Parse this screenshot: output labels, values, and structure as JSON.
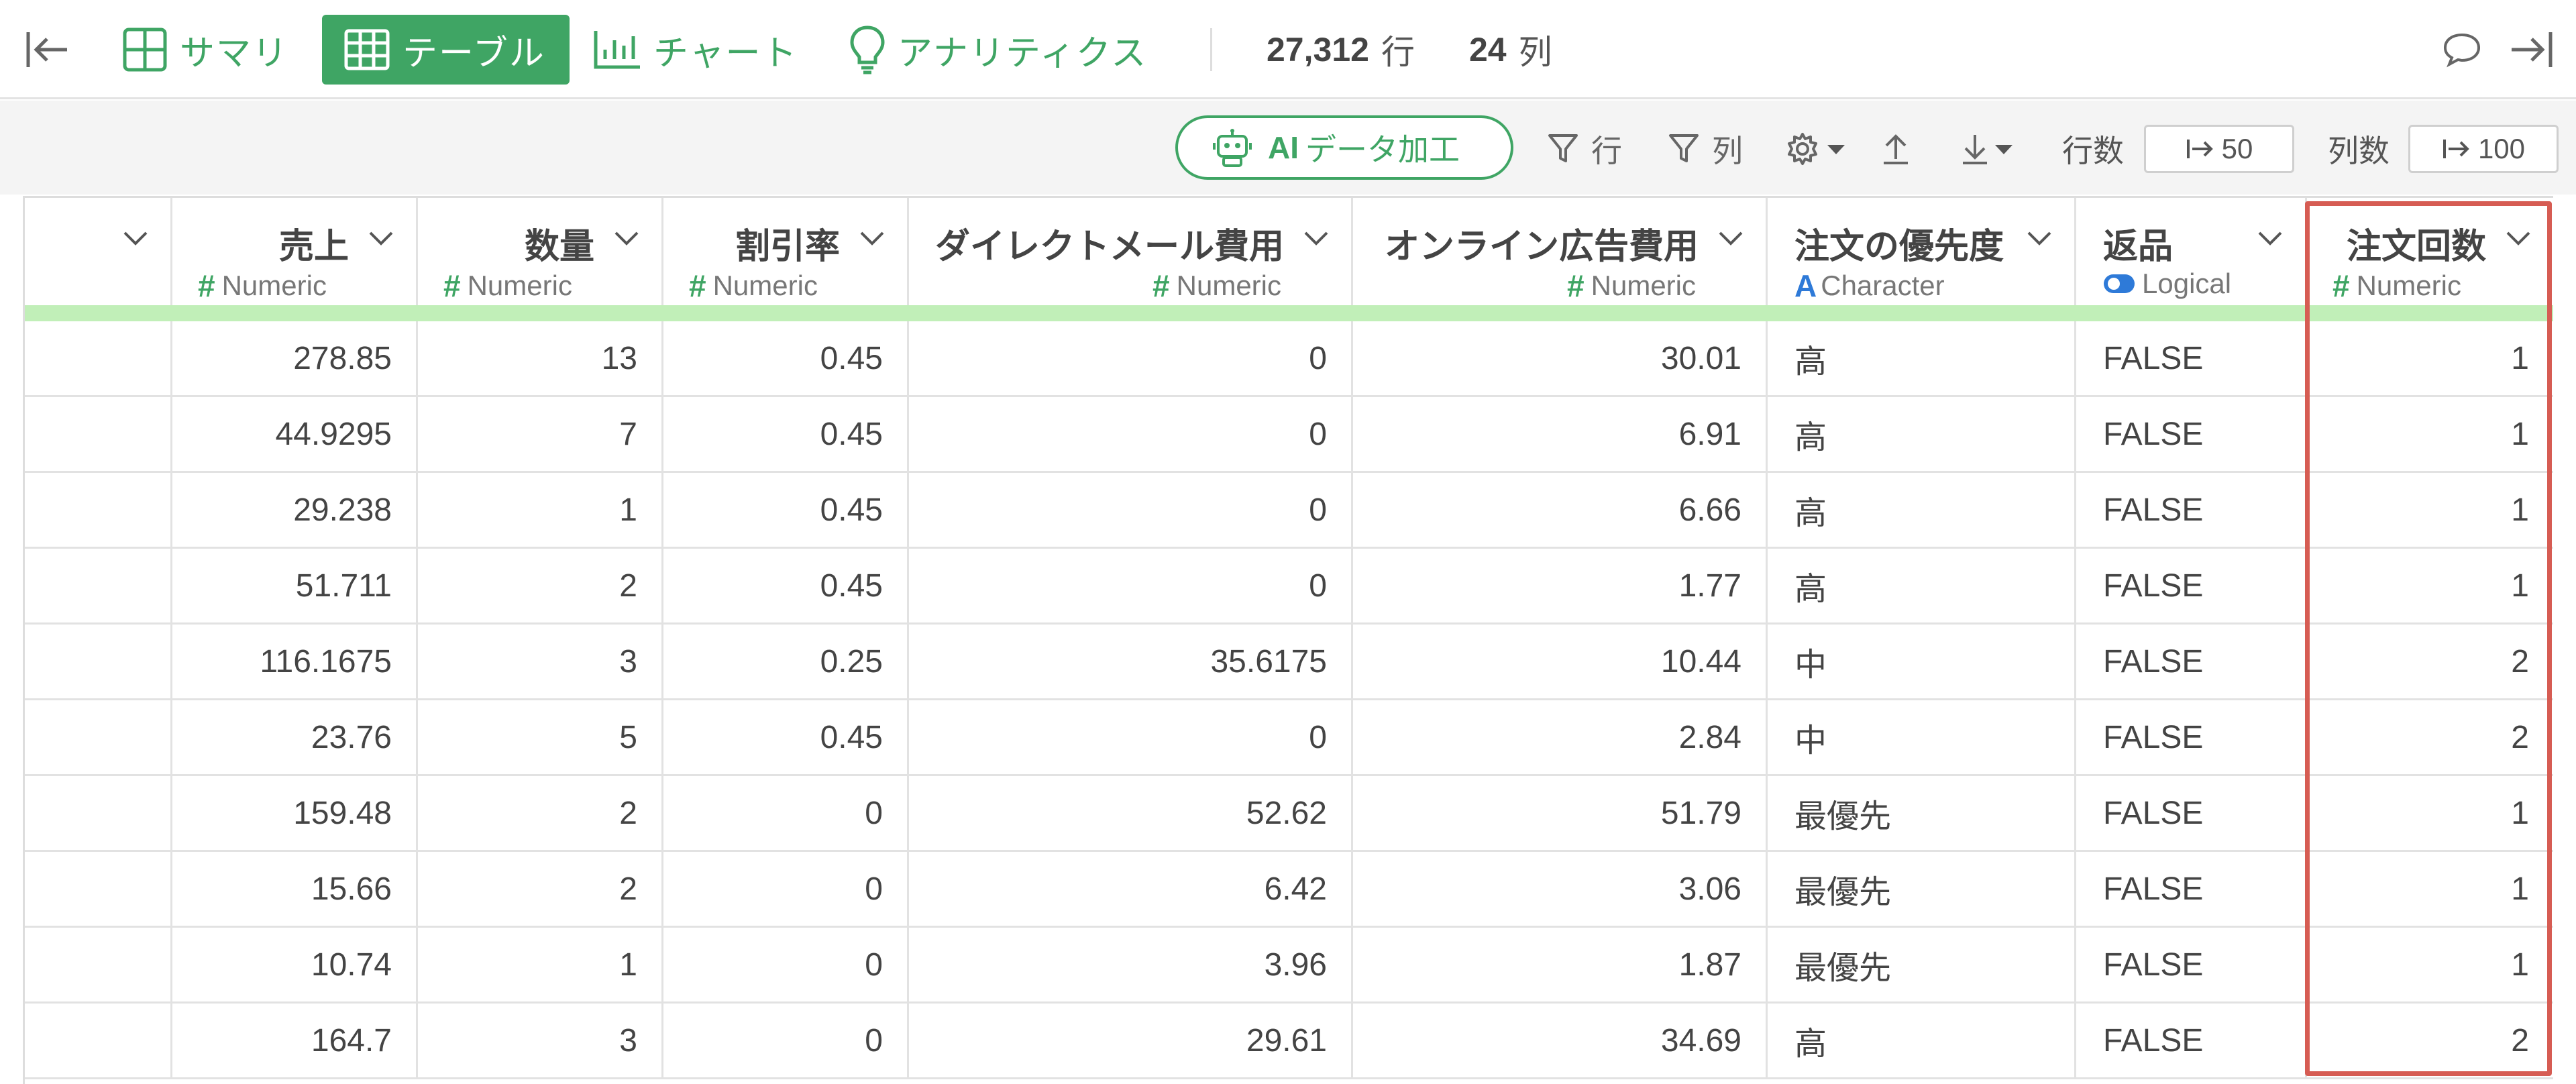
{
  "nav": {
    "tabs": [
      {
        "label": "サマリ",
        "icon": "summary-grid-icon"
      },
      {
        "label": "テーブル",
        "icon": "table-icon",
        "active": true
      },
      {
        "label": "チャート",
        "icon": "bar-chart-icon"
      },
      {
        "label": "アナリティクス",
        "icon": "lightbulb-icon"
      }
    ],
    "rows_count": "27,312",
    "rows_unit": "行",
    "cols_count": "24",
    "cols_unit": "列"
  },
  "toolbar": {
    "ai_strong": "AI",
    "ai_label": "データ加工",
    "row_filter": "行",
    "col_filter": "列",
    "rows_label": "行数",
    "rows_value": "50",
    "cols_label": "列数",
    "cols_value": "100"
  },
  "table": {
    "columns": [
      {
        "name": "",
        "type": ""
      },
      {
        "name": "売上",
        "type": "Numeric"
      },
      {
        "name": "数量",
        "type": "Numeric"
      },
      {
        "name": "割引率",
        "type": "Numeric"
      },
      {
        "name": "ダイレクトメール費用",
        "type": "Numeric"
      },
      {
        "name": "オンライン広告費用",
        "type": "Numeric"
      },
      {
        "name": "注文の優先度",
        "type": "Character"
      },
      {
        "name": "返品",
        "type": "Logical"
      },
      {
        "name": "注文回数",
        "type": "Numeric"
      }
    ],
    "rows": [
      [
        "",
        "278.85",
        "13",
        "0.45",
        "0",
        "30.01",
        "高",
        "FALSE",
        "1"
      ],
      [
        "",
        "44.9295",
        "7",
        "0.45",
        "0",
        "6.91",
        "高",
        "FALSE",
        "1"
      ],
      [
        "",
        "29.238",
        "1",
        "0.45",
        "0",
        "6.66",
        "高",
        "FALSE",
        "1"
      ],
      [
        "",
        "51.711",
        "2",
        "0.45",
        "0",
        "1.77",
        "高",
        "FALSE",
        "1"
      ],
      [
        "",
        "116.1675",
        "3",
        "0.25",
        "35.6175",
        "10.44",
        "中",
        "FALSE",
        "2"
      ],
      [
        "",
        "23.76",
        "5",
        "0.45",
        "0",
        "2.84",
        "中",
        "FALSE",
        "2"
      ],
      [
        "",
        "159.48",
        "2",
        "0",
        "52.62",
        "51.79",
        "最優先",
        "FALSE",
        "1"
      ],
      [
        "",
        "15.66",
        "2",
        "0",
        "6.42",
        "3.06",
        "最優先",
        "FALSE",
        "1"
      ],
      [
        "",
        "10.74",
        "1",
        "0",
        "3.96",
        "1.87",
        "最優先",
        "FALSE",
        "1"
      ],
      [
        "",
        "164.7",
        "3",
        "0",
        "29.61",
        "34.69",
        "高",
        "FALSE",
        "2"
      ]
    ]
  },
  "colors": {
    "accent": "#3fa564",
    "highlight": "#d65c53",
    "header_bar": "#c1efb8"
  }
}
